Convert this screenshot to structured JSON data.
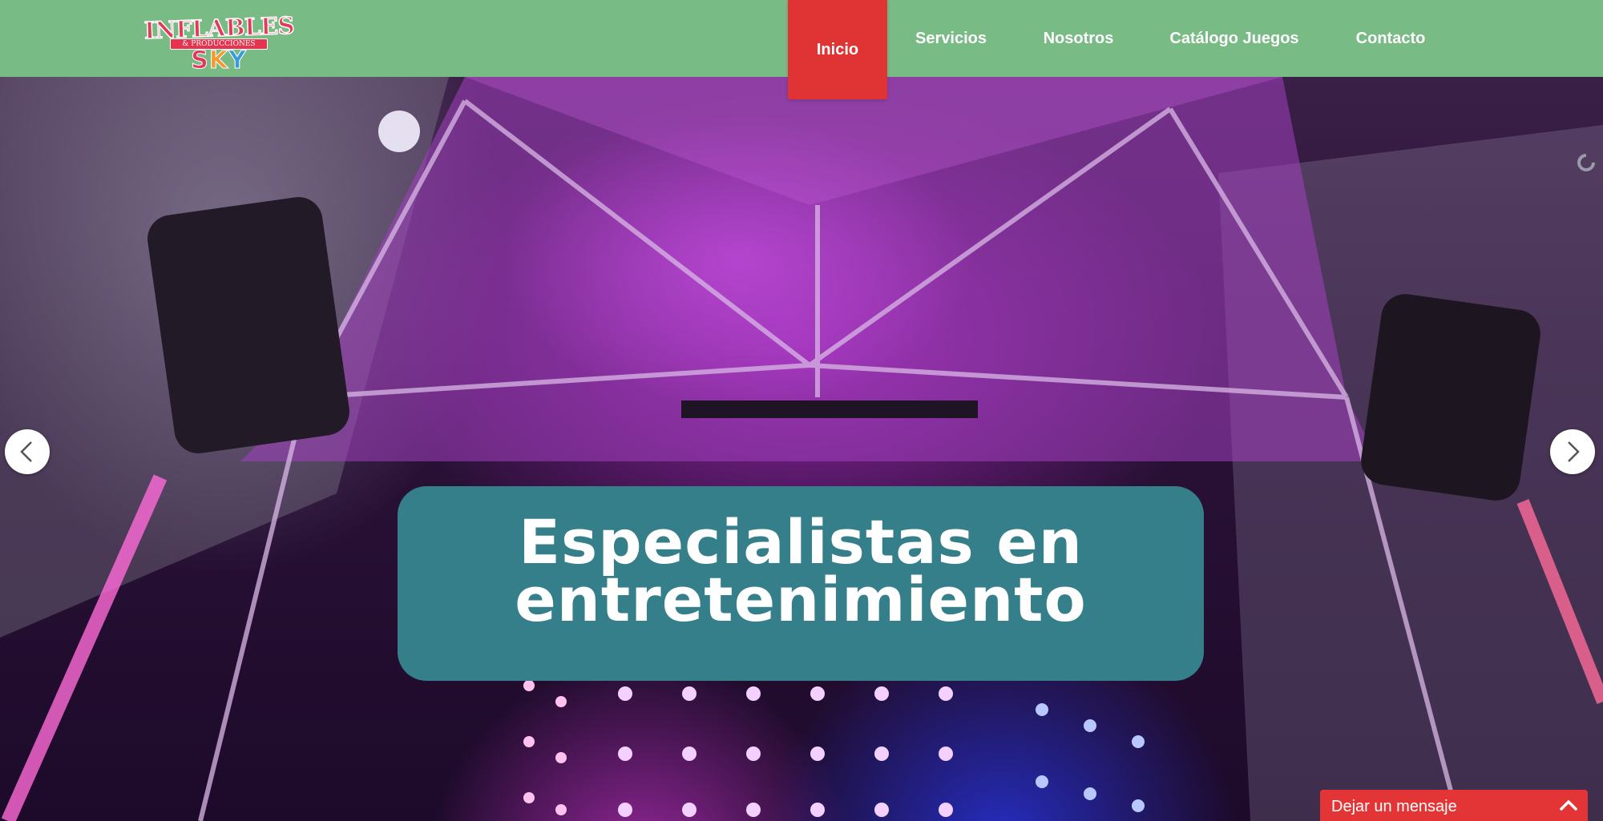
{
  "logo": {
    "line1": "INFLABLES",
    "line2": "& PRODUCCIONES",
    "line3_letters": [
      "S",
      "K",
      "Y"
    ]
  },
  "nav": {
    "items": [
      {
        "label": "Inicio",
        "active": true
      },
      {
        "label": "Servicios",
        "active": false
      },
      {
        "label": "Nosotros",
        "active": false
      },
      {
        "label": "Catálogo Juegos",
        "active": false
      },
      {
        "label": "Contacto",
        "active": false
      }
    ]
  },
  "hero": {
    "caption_line1": "Especialistas en",
    "caption_line2": "entretenimiento",
    "prev_icon": "chevron-left-icon",
    "next_icon": "chevron-right-icon"
  },
  "chat": {
    "label": "Dejar un mensaje",
    "icon": "chevron-up-icon"
  },
  "colors": {
    "header_bg": "#79bb84",
    "nav_active_bg": "#e03434",
    "caption_bg": "#347f8a",
    "chat_bg": "#e33535"
  }
}
